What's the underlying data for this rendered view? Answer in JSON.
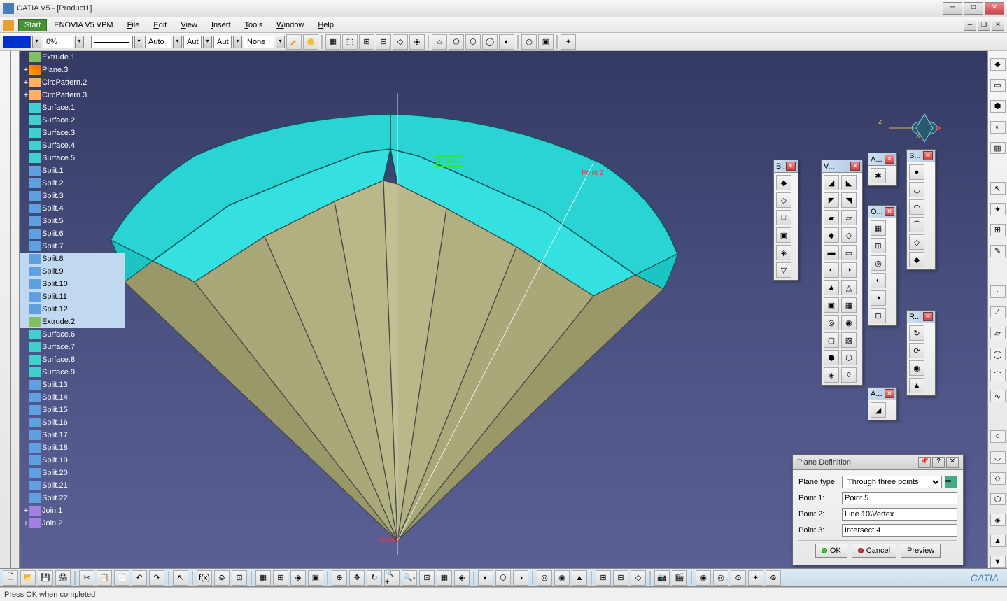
{
  "title": "CATIA V5 - [Product1]",
  "menus": {
    "start": "Start",
    "enovia": "ENOVIA V5 VPM",
    "file": "File",
    "edit": "Edit",
    "view": "View",
    "insert": "Insert",
    "tools": "Tools",
    "window": "Window",
    "help": "Help"
  },
  "toolbar": {
    "opacity": "0%",
    "lw_auto": "Auto",
    "auto1": "Aut",
    "auto2": "Aut",
    "transp": "None"
  },
  "tree": [
    {
      "icon": "ext",
      "label": "Extrude.1",
      "indent": 0,
      "exp": ""
    },
    {
      "icon": "plane",
      "label": "Plane.3",
      "indent": 0,
      "exp": "+"
    },
    {
      "icon": "circ",
      "label": "CircPattern.2",
      "indent": 0,
      "exp": "+"
    },
    {
      "icon": "circ",
      "label": "CircPattern.3",
      "indent": 0,
      "exp": "+"
    },
    {
      "icon": "surf",
      "label": "Surface.1",
      "indent": 0,
      "exp": ""
    },
    {
      "icon": "surf",
      "label": "Surface.2",
      "indent": 0,
      "exp": ""
    },
    {
      "icon": "surf",
      "label": "Surface.3",
      "indent": 0,
      "exp": ""
    },
    {
      "icon": "surf",
      "label": "Surface.4",
      "indent": 0,
      "exp": ""
    },
    {
      "icon": "surf",
      "label": "Surface.5",
      "indent": 0,
      "exp": ""
    },
    {
      "icon": "split",
      "label": "Split.1",
      "indent": 0,
      "exp": ""
    },
    {
      "icon": "split",
      "label": "Split.2",
      "indent": 0,
      "exp": ""
    },
    {
      "icon": "split",
      "label": "Split.3",
      "indent": 0,
      "exp": ""
    },
    {
      "icon": "split",
      "label": "Split.4",
      "indent": 0,
      "exp": ""
    },
    {
      "icon": "split",
      "label": "Split.5",
      "indent": 0,
      "exp": ""
    },
    {
      "icon": "split",
      "label": "Split.6",
      "indent": 0,
      "exp": ""
    },
    {
      "icon": "split",
      "label": "Split.7",
      "indent": 0,
      "exp": ""
    },
    {
      "icon": "split",
      "label": "Split.8",
      "indent": 0,
      "exp": "",
      "sel": true
    },
    {
      "icon": "split",
      "label": "Split.9",
      "indent": 0,
      "exp": "",
      "sel": true
    },
    {
      "icon": "split",
      "label": "Split.10",
      "indent": 0,
      "exp": "",
      "sel": true
    },
    {
      "icon": "split",
      "label": "Split.11",
      "indent": 0,
      "exp": "",
      "sel": true
    },
    {
      "icon": "split",
      "label": "Split.12",
      "indent": 0,
      "exp": "",
      "sel": true
    },
    {
      "icon": "ext",
      "label": "Extrude.2",
      "indent": 0,
      "exp": "",
      "sel": true
    },
    {
      "icon": "surf",
      "label": "Surface.6",
      "indent": 0,
      "exp": ""
    },
    {
      "icon": "surf",
      "label": "Surface.7",
      "indent": 0,
      "exp": ""
    },
    {
      "icon": "surf",
      "label": "Surface.8",
      "indent": 0,
      "exp": ""
    },
    {
      "icon": "surf",
      "label": "Surface.9",
      "indent": 0,
      "exp": ""
    },
    {
      "icon": "split",
      "label": "Split.13",
      "indent": 0,
      "exp": ""
    },
    {
      "icon": "split",
      "label": "Split.14",
      "indent": 0,
      "exp": ""
    },
    {
      "icon": "split",
      "label": "Split.15",
      "indent": 0,
      "exp": ""
    },
    {
      "icon": "split",
      "label": "Split.16",
      "indent": 0,
      "exp": ""
    },
    {
      "icon": "split",
      "label": "Split.17",
      "indent": 0,
      "exp": ""
    },
    {
      "icon": "split",
      "label": "Split.18",
      "indent": 0,
      "exp": ""
    },
    {
      "icon": "split",
      "label": "Split.19",
      "indent": 0,
      "exp": ""
    },
    {
      "icon": "split",
      "label": "Split.20",
      "indent": 0,
      "exp": ""
    },
    {
      "icon": "split",
      "label": "Split.21",
      "indent": 0,
      "exp": ""
    },
    {
      "icon": "split",
      "label": "Split.22",
      "indent": 0,
      "exp": ""
    },
    {
      "icon": "join",
      "label": "Join.1",
      "indent": 0,
      "exp": "+"
    },
    {
      "icon": "join",
      "label": "Join.2",
      "indent": 0,
      "exp": "+"
    }
  ],
  "annotations": {
    "p1": "Point 1",
    "p2": "Point 2",
    "p3": "Point 3"
  },
  "compass": {
    "x": "x",
    "z": "z"
  },
  "palettes": {
    "bi": {
      "title": "Bi..."
    },
    "v": {
      "title": "V..."
    },
    "a1": {
      "title": "A..."
    },
    "o": {
      "title": "O..."
    },
    "a2": {
      "title": "A..."
    },
    "s": {
      "title": "S..."
    },
    "r": {
      "title": "R..."
    }
  },
  "dialog": {
    "title": "Plane Definition",
    "type_label": "Plane type:",
    "type_value": "Through three points",
    "p1_label": "Point 1:",
    "p1_value": "Point.5",
    "p2_label": "Point 2:",
    "p2_value": "Line.10\\Vertex",
    "p3_label": "Point 3:",
    "p3_value": "Intersect.4",
    "ok": "OK",
    "cancel": "Cancel",
    "preview": "Preview"
  },
  "status": "Press OK when completed"
}
